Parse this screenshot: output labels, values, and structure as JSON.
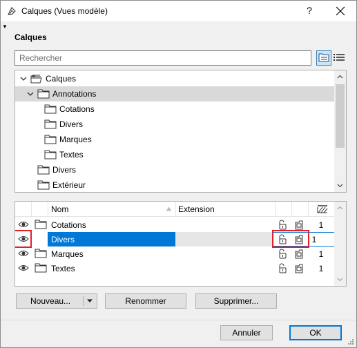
{
  "window": {
    "title": "Calques (Vues modèle)",
    "help_label": "?",
    "close_label": "✕"
  },
  "section_title": "Calques",
  "search": {
    "placeholder": "Rechercher",
    "value": ""
  },
  "tree": {
    "items": [
      {
        "label": "Calques",
        "expanded": true,
        "level": 0,
        "selected": false
      },
      {
        "label": "Annotations",
        "expanded": true,
        "level": 1,
        "selected": true
      },
      {
        "label": "Cotations",
        "level": 2,
        "selected": false
      },
      {
        "label": "Divers",
        "level": 2,
        "selected": false
      },
      {
        "label": "Marques",
        "level": 2,
        "selected": false
      },
      {
        "label": "Textes",
        "level": 2,
        "selected": false
      },
      {
        "label": "Divers",
        "level": 1,
        "selected": false
      },
      {
        "label": "Extérieur",
        "level": 1,
        "selected": false
      }
    ]
  },
  "list": {
    "columns": {
      "name": "Nom",
      "extension": "Extension"
    },
    "rows": [
      {
        "name": "Cotations",
        "value": "1",
        "selected": false
      },
      {
        "name": "Divers",
        "value": "1",
        "selected": true
      },
      {
        "name": "Marques",
        "value": "1",
        "selected": false
      },
      {
        "name": "Textes",
        "value": "1",
        "selected": false
      }
    ]
  },
  "buttons": {
    "new": "Nouveau...",
    "rename": "Renommer",
    "delete": "Supprimer...",
    "cancel": "Annuler",
    "ok": "OK"
  },
  "colors": {
    "selection": "#0078d7",
    "highlight_box": "#e0202a",
    "tree_selected": "#d9d9d9"
  }
}
